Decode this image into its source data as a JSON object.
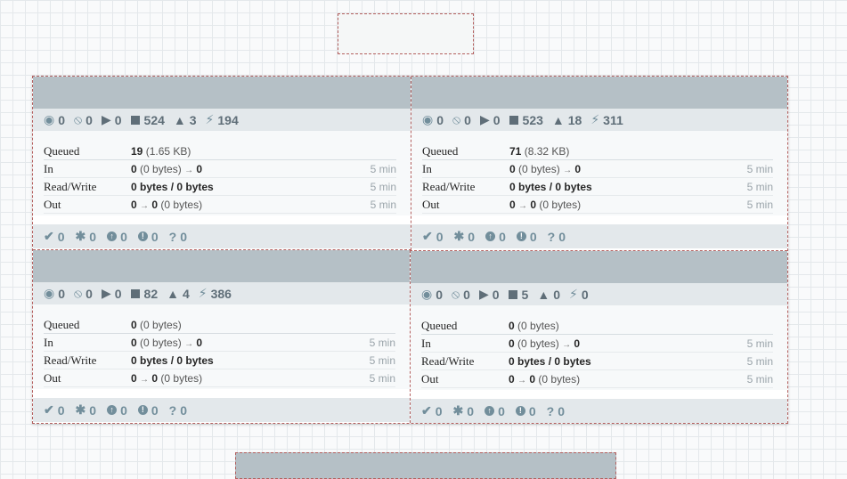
{
  "colors": {
    "header": "#b5c0c6",
    "counts_bar": "#e3e8eb",
    "dashed_border": "#b4605f",
    "icon": "#728e9b"
  },
  "icons": {
    "transmitting": "transmitting-icon",
    "not_transmitting": "not-transmitting-icon",
    "running": "running-icon",
    "stopped": "stopped-icon",
    "invalid": "invalid-icon",
    "disabled": "disabled-icon",
    "up_to_date": "up-to-date-icon",
    "locally_modified": "locally-modified-icon",
    "stale": "stale-icon",
    "sync_failure": "sync-failure-icon",
    "unknown": "unknown-icon"
  },
  "labels": {
    "queued": "Queued",
    "in": "In",
    "read_write": "Read/Write",
    "out": "Out",
    "time": "5 min",
    "arrow": "→"
  },
  "groups": [
    {
      "counts": {
        "transmitting": "0",
        "not_transmitting": "0",
        "running": "0",
        "stopped": "524",
        "invalid": "3",
        "disabled": "194"
      },
      "queued_count": "19",
      "queued_size": "(1.65 KB)",
      "in_count": "0",
      "in_size": "(0 bytes)",
      "in_out": "0",
      "read_write": "0 bytes / 0 bytes",
      "out_count": "0",
      "out_out": "0",
      "out_size": "(0 bytes)",
      "footer": {
        "up_to_date": "0",
        "locally_modified": "0",
        "stale": "0",
        "sync_failure": "0",
        "unknown": "0"
      }
    },
    {
      "counts": {
        "transmitting": "0",
        "not_transmitting": "0",
        "running": "0",
        "stopped": "523",
        "invalid": "18",
        "disabled": "311"
      },
      "queued_count": "71",
      "queued_size": "(8.32 KB)",
      "in_count": "0",
      "in_size": "(0 bytes)",
      "in_out": "0",
      "read_write": "0 bytes / 0 bytes",
      "out_count": "0",
      "out_out": "0",
      "out_size": "(0 bytes)",
      "footer": {
        "up_to_date": "0",
        "locally_modified": "0",
        "stale": "0",
        "sync_failure": "0",
        "unknown": "0"
      }
    },
    {
      "counts": {
        "transmitting": "0",
        "not_transmitting": "0",
        "running": "0",
        "stopped": "82",
        "invalid": "4",
        "disabled": "386"
      },
      "queued_count": "0",
      "queued_size": "(0 bytes)",
      "in_count": "0",
      "in_size": "(0 bytes)",
      "in_out": "0",
      "read_write": "0 bytes / 0 bytes",
      "out_count": "0",
      "out_out": "0",
      "out_size": "(0 bytes)",
      "footer": {
        "up_to_date": "0",
        "locally_modified": "0",
        "stale": "0",
        "sync_failure": "0",
        "unknown": "0"
      }
    },
    {
      "counts": {
        "transmitting": "0",
        "not_transmitting": "0",
        "running": "0",
        "stopped": "5",
        "invalid": "0",
        "disabled": "0"
      },
      "queued_count": "0",
      "queued_size": "(0 bytes)",
      "in_count": "0",
      "in_size": "(0 bytes)",
      "in_out": "0",
      "read_write": "0 bytes / 0 bytes",
      "out_count": "0",
      "out_out": "0",
      "out_size": "(0 bytes)",
      "footer": {
        "up_to_date": "0",
        "locally_modified": "0",
        "stale": "0",
        "sync_failure": "0",
        "unknown": "0"
      }
    }
  ]
}
